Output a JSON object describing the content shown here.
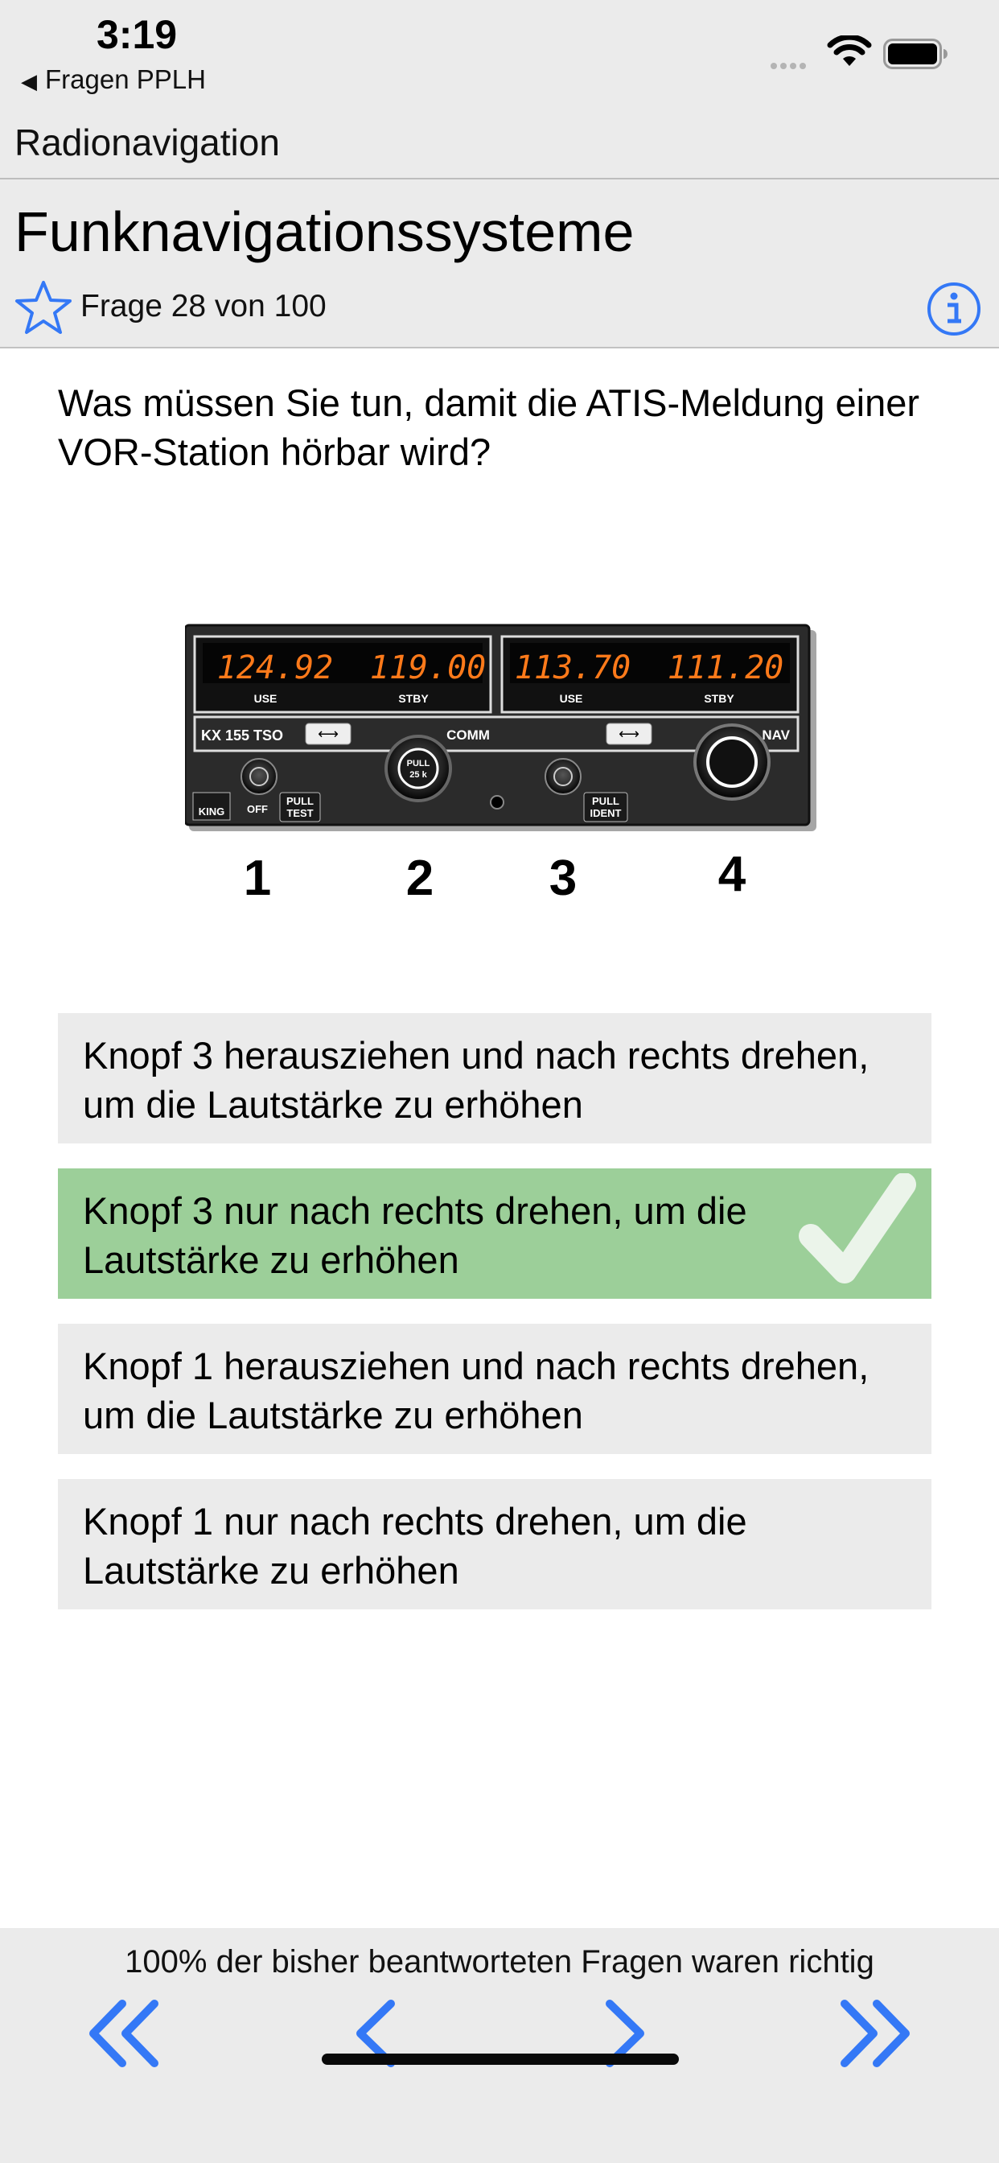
{
  "status": {
    "time": "3:19",
    "back_label": "Fragen PPLH"
  },
  "nav": {
    "category": "Radionavigation"
  },
  "header": {
    "title": "Funknavigationssysteme",
    "counter": "Frage 28 von 100"
  },
  "question": {
    "text": "Was müssen Sie tun, damit die ATIS-Meldung einer VOR-Station hörbar wird?"
  },
  "device": {
    "comm_use": "124.92",
    "comm_stby": "119.00",
    "nav_use": "113.70",
    "nav_stby": "111.20",
    "use_label": "USE",
    "stby_label": "STBY",
    "model": "KX 155 TSO",
    "comm_label": "COMM",
    "nav_label": "NAV",
    "pull_25k": [
      "PULL",
      "25 k"
    ],
    "pull_test": [
      "PULL",
      "TEST"
    ],
    "pull_ident": [
      "PULL",
      "IDENT"
    ],
    "off_label": "OFF",
    "brand": "KING",
    "knob_numbers": [
      "1",
      "2",
      "3",
      "4"
    ]
  },
  "answers": [
    {
      "text": "Knopf 3 herausziehen und nach rechts drehen, um die Lautstärke zu erhöhen",
      "correct": false
    },
    {
      "text": "Knopf 3 nur nach rechts drehen, um die Lautstärke zu erhöhen",
      "correct": true
    },
    {
      "text": "Knopf 1 herausziehen und nach rechts drehen, um die Lautstärke zu erhöhen",
      "correct": false
    },
    {
      "text": "Knopf 1 nur nach rechts drehen, um die Lautstärke zu erhöhen",
      "correct": false
    }
  ],
  "footer": {
    "stats": "100% der bisher beantworteten Fragen waren richtig"
  },
  "colors": {
    "accent": "#3478f6",
    "correct_bg": "#9ccf99",
    "bar_bg": "#ebebeb",
    "display_text": "#ff7a1a"
  },
  "icons": [
    "back-triangle-icon",
    "wifi-icon",
    "battery-icon",
    "star-icon",
    "info-icon",
    "checkmark-icon",
    "first-icon",
    "previous-icon",
    "next-icon",
    "last-icon"
  ]
}
